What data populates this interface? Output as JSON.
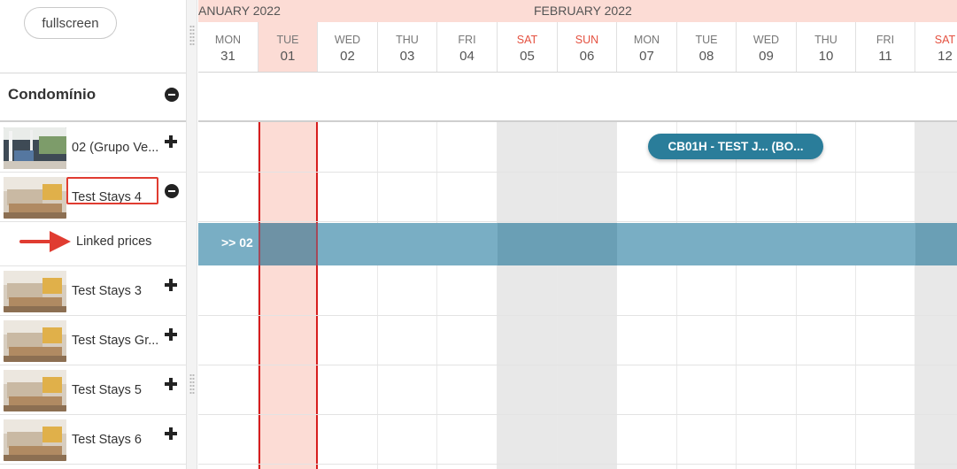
{
  "toolbar": {
    "fullscreen_label": "fullscreen"
  },
  "group": {
    "title": "Condomínio"
  },
  "rooms": [
    {
      "name": "02 (Grupo Ve...",
      "toggle": "expand"
    },
    {
      "name": "Test Stays 4",
      "toggle": "collapse"
    },
    {
      "name": "Test Stays 3",
      "toggle": "expand"
    },
    {
      "name": "Test Stays Gr...",
      "toggle": "expand"
    },
    {
      "name": "Test Stays 5",
      "toggle": "expand"
    },
    {
      "name": "Test Stays 6",
      "toggle": "expand"
    }
  ],
  "linked": {
    "label": "Linked prices",
    "band_text": ">> 02"
  },
  "months": [
    {
      "label": "ANUARY 2022"
    },
    {
      "label": "FEBRUARY 2022"
    }
  ],
  "days": [
    {
      "dow": "MON",
      "num": "31"
    },
    {
      "dow": "TUE",
      "num": "01"
    },
    {
      "dow": "WED",
      "num": "02"
    },
    {
      "dow": "THU",
      "num": "03"
    },
    {
      "dow": "FRI",
      "num": "04"
    },
    {
      "dow": "SAT",
      "num": "05"
    },
    {
      "dow": "SUN",
      "num": "06"
    },
    {
      "dow": "MON",
      "num": "07"
    },
    {
      "dow": "TUE",
      "num": "08"
    },
    {
      "dow": "WED",
      "num": "09"
    },
    {
      "dow": "THU",
      "num": "10"
    },
    {
      "dow": "FRI",
      "num": "11"
    },
    {
      "dow": "SAT",
      "num": "12"
    }
  ],
  "booking": {
    "label": "CB01H - TEST J... (BO..."
  },
  "colors": {
    "today": "#fcdcd5",
    "today_border": "#d71e1e",
    "weekend_text": "#e4503f",
    "weekend_col": "#e8e8e8",
    "linked_band": "#79aec4",
    "booking": "#2a7d9a",
    "annotation": "#e03c31"
  }
}
